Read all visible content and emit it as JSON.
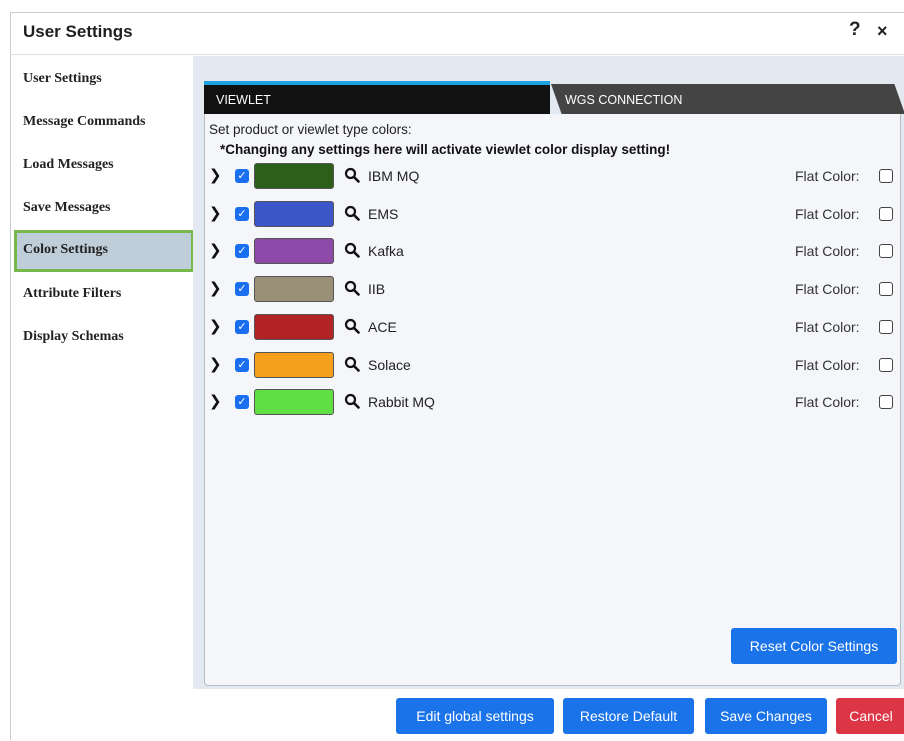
{
  "window": {
    "title": "User Settings",
    "help_label": "?",
    "close_label": "×"
  },
  "sidebar": {
    "items": [
      {
        "label": "User Settings",
        "active": false
      },
      {
        "label": "Message Commands",
        "active": false
      },
      {
        "label": "Load Messages",
        "active": false
      },
      {
        "label": "Save Messages",
        "active": false
      },
      {
        "label": "Color Settings",
        "active": true
      },
      {
        "label": "Attribute Filters",
        "active": false
      },
      {
        "label": "Display Schemas",
        "active": false
      }
    ]
  },
  "tabs": [
    {
      "label": "VIEWLET",
      "active": true
    },
    {
      "label": "WGS CONNECTION",
      "active": false
    }
  ],
  "panel": {
    "intro": "Set product or viewlet type colors:",
    "warning": "*Changing any settings here will activate viewlet color display setting!",
    "flat_color_label": "Flat Color:",
    "rows": [
      {
        "name": "IBM MQ",
        "color": "#2d5e1a",
        "checked": true,
        "flat": false
      },
      {
        "name": "EMS",
        "color": "#3a56c9",
        "checked": true,
        "flat": false
      },
      {
        "name": "Kafka",
        "color": "#8e4aa8",
        "checked": true,
        "flat": false
      },
      {
        "name": "IIB",
        "color": "#9a9078",
        "checked": true,
        "flat": false
      },
      {
        "name": "ACE",
        "color": "#b22327",
        "checked": true,
        "flat": false
      },
      {
        "name": "Solace",
        "color": "#f5a01c",
        "checked": true,
        "flat": false
      },
      {
        "name": "Rabbit MQ",
        "color": "#5fdf44",
        "checked": true,
        "flat": false
      }
    ],
    "reset_label": "Reset Color Settings"
  },
  "footer": {
    "edit_global_label": "Edit global settings",
    "restore_label": "Restore Default",
    "save_label": "Save Changes",
    "cancel_label": "Cancel"
  },
  "colors": {
    "accent_blue": "#1a73e8",
    "cancel_red": "#dc3545",
    "active_tab_border": "#1ca2e0",
    "active_item_border": "#76b84c"
  }
}
